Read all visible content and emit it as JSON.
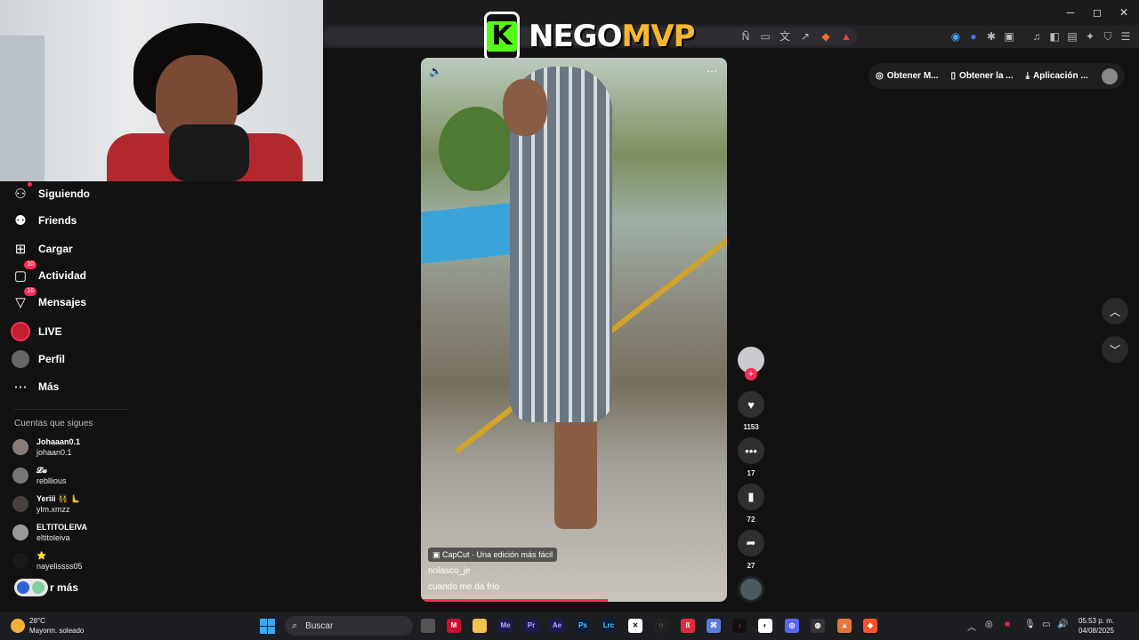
{
  "overlay": {
    "logo_letter": "K",
    "logo_part1": "NEGO",
    "logo_part2": "MVP"
  },
  "sidebar": {
    "items": [
      {
        "label": "Siguiendo",
        "icon": "following-icon"
      },
      {
        "label": "Friends",
        "icon": "friends-icon"
      },
      {
        "label": "Cargar",
        "icon": "upload-icon"
      },
      {
        "label": "Actividad",
        "icon": "activity-icon",
        "badge": "10"
      },
      {
        "label": "Mensajes",
        "icon": "messages-icon",
        "badge": "16"
      },
      {
        "label": "LIVE",
        "icon": "live-avatar"
      },
      {
        "label": "Perfil",
        "icon": "profile-avatar"
      },
      {
        "label": "Más",
        "icon": "more-dots-icon"
      }
    ],
    "following_title": "Cuentas que sigues",
    "following": [
      {
        "name": "Johaaan0.1",
        "user": "johaan0.1"
      },
      {
        "name": "𝓛𝓾",
        "user": "rebllious"
      },
      {
        "name": "Yeriii 👯‍♀️ 🫷",
        "user": "ylm.xmzz"
      },
      {
        "name": "ELTITOLEIVA",
        "user": "eltitoleiva"
      },
      {
        "name": "⭐",
        "user": "nayelissss05"
      }
    ],
    "see_more": "r más"
  },
  "video": {
    "capcut": "CapCut · Una edición más fácil",
    "username": "nolasco_je",
    "caption": "cuando me da frio",
    "progress": 0.61
  },
  "actions": {
    "likes": "1153",
    "comments": "17",
    "saves": "72",
    "shares": "27"
  },
  "top_right": {
    "items": [
      "Obtener M...",
      "Obtener la ...",
      "Aplicación ..."
    ]
  },
  "taskbar": {
    "temp": "28°C",
    "weather": "Mayorm. soleado",
    "search": "Buscar",
    "time": "05:53 p. m.",
    "date": "04/08/2025"
  },
  "colors": {
    "accent": "#fe2c55",
    "background": "#121212",
    "kick_green": "#53fc18",
    "logo_gold": "#f6b630"
  }
}
